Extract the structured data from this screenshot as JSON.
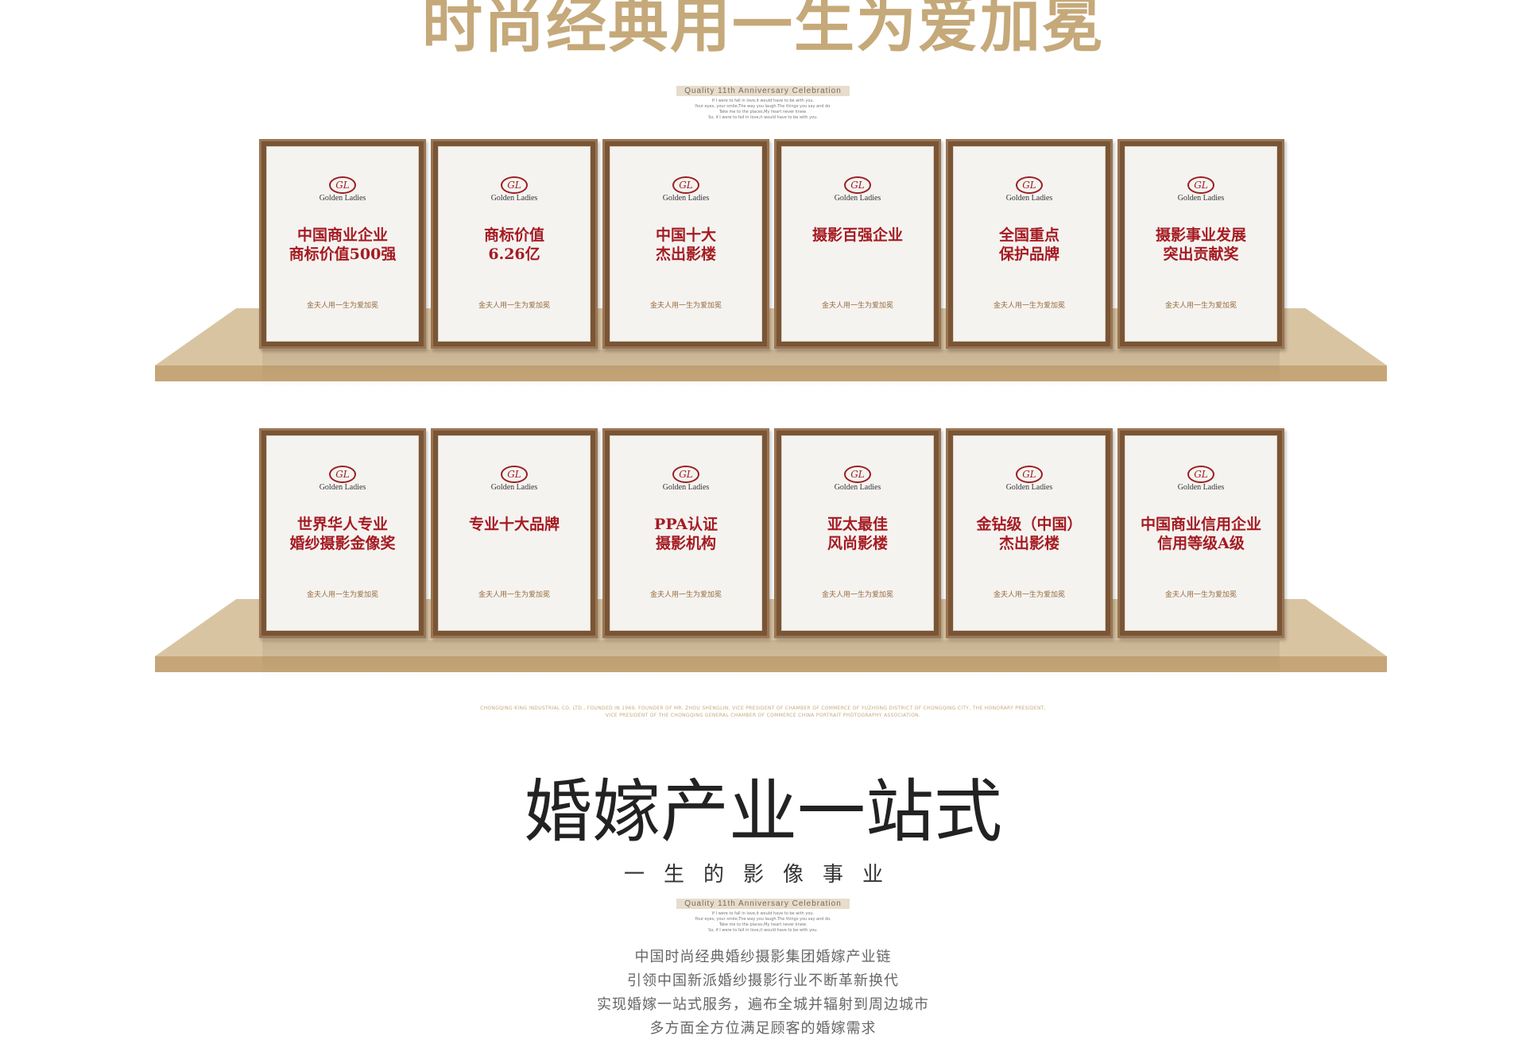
{
  "headline": "时尚经典用一生为爱加冕",
  "tag": {
    "label": "Quality 11th Anniversary Celebration",
    "poem": [
      "If I were to fall in love,it would have to be with you.",
      "Your eyes, your smile,The way you laugh.The things you say and do.",
      "Take me to the places,My heart never knew.",
      "So, if I were to fall in love,it would have to be with you."
    ]
  },
  "brand": {
    "logo_letter": "GL",
    "logo_text": "Golden Ladies",
    "motto": "金夫人用一生为爱加冕"
  },
  "shelves": [
    {
      "plaques": [
        "中国商业企业\n商标价值500强",
        "商标价值\n6.26亿",
        "中国十大\n杰出影楼",
        "摄影百强企业",
        "全国重点\n保护品牌",
        "摄影事业发展\n突出贡献奖"
      ]
    },
    {
      "plaques": [
        "世界华人专业\n婚纱摄影金像奖",
        "专业十大品牌",
        "PPA认证\n摄影机构",
        "亚太最佳\n风尚影楼",
        "金钻级（中国）\n杰出影楼",
        "中国商业信用企业\n信用等级A级"
      ]
    }
  ],
  "company_info": [
    "CHONGQING KING INDUSTRIAL CO. LTD., FOUNDED IN 1969, FOUNDER OF MR. ZHOU SHENGLIN, VICE PRESIDENT OF CHAMBER OF COMMERCE OF YUZHONG DISTRICT OF CHONGQING CITY, THE HONORARY PRESIDENT,",
    "VICE PRESIDENT OF THE CHONGQING GENERAL CHAMBER OF COMMERCE CHINA PORTRAIT PHOTOGRAPHY ASSOCIATION."
  ],
  "section": {
    "title": "婚嫁产业一站式",
    "subtitle": "一生的影像事业",
    "description": [
      "中国时尚经典婚纱摄影集团婚嫁产业链",
      "引领中国新派婚纱摄影行业不断革新换代",
      "实现婚嫁一站式服务，遍布全城并辐射到周边城市",
      "多方面全方位满足顾客的婚嫁需求"
    ]
  },
  "colors": {
    "gold": "#c5a97a",
    "award_red": "#a51b22",
    "shelf": "#d9c4a2",
    "frame": "#7a5535"
  }
}
